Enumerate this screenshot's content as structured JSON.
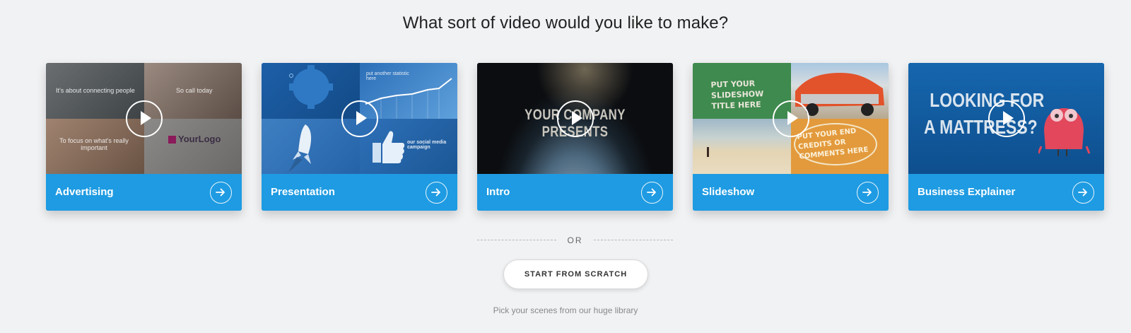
{
  "heading": "What sort of video would you like to make?",
  "cards": [
    {
      "label": "Advertising",
      "thumb_text": [
        "It's about connecting people",
        "So call today",
        "To focus on what's really important",
        "YourLogo"
      ]
    },
    {
      "label": "Presentation",
      "thumb_text": [
        "put another statistic here",
        "our social media campaign"
      ]
    },
    {
      "label": "Intro",
      "thumb_text": [
        "YOUR COMPANY PRESENTS"
      ]
    },
    {
      "label": "Slideshow",
      "thumb_text": [
        "PUT YOUR SLIDESHOW TITLE HERE",
        "PUT YOUR END CREDITS OR COMMENTS HERE"
      ]
    },
    {
      "label": "Business Explainer",
      "thumb_text": [
        "LOOKING FOR",
        "A MATTRESS?"
      ]
    }
  ],
  "divider_label": "OR",
  "scratch_button": "START FROM SCRATCH",
  "scratch_subtitle": "Pick your scenes from our huge library",
  "colors": {
    "accent": "#1e9be2",
    "background": "#f1f2f4"
  }
}
